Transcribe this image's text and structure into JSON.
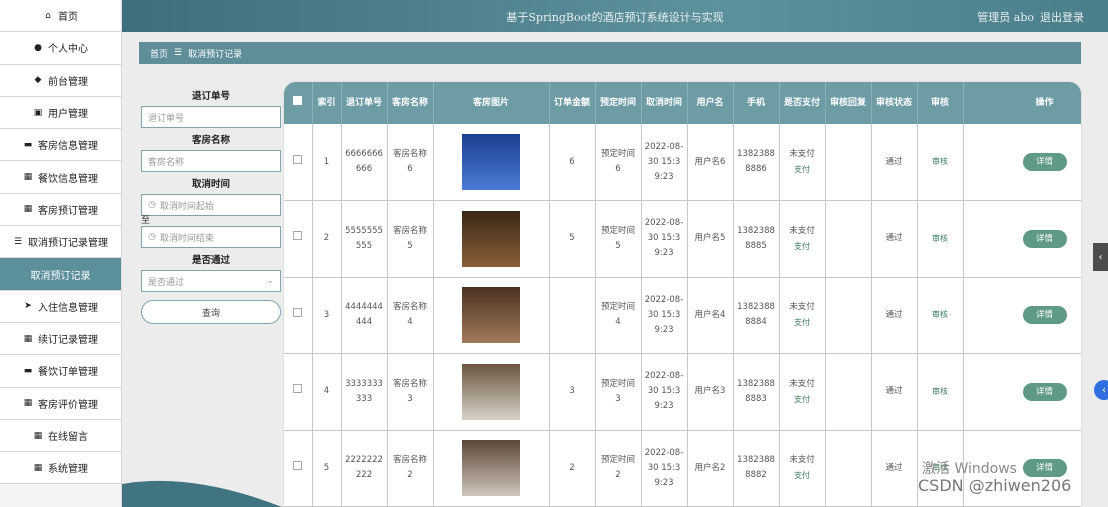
{
  "sidebar": {
    "items": [
      {
        "label": "首页",
        "icon": "home-icon",
        "glyph": "⌂"
      },
      {
        "label": "个人中心",
        "icon": "user-icon",
        "glyph": "●"
      },
      {
        "label": "前台管理",
        "icon": "pin-icon",
        "glyph": "◆"
      },
      {
        "label": "用户管理",
        "icon": "check-box-icon",
        "glyph": "▣"
      },
      {
        "label": "客房信息管理",
        "icon": "comment-icon",
        "glyph": "▬"
      },
      {
        "label": "餐饮信息管理",
        "icon": "grid-icon",
        "glyph": "▦"
      },
      {
        "label": "客房预订管理",
        "icon": "grid-icon",
        "glyph": "▦"
      },
      {
        "label": "取消预订记录管理",
        "icon": "sliders-icon",
        "glyph": "☰"
      },
      {
        "label": "取消预订记录",
        "icon": "",
        "glyph": ""
      },
      {
        "label": "入住信息管理",
        "icon": "send-icon",
        "glyph": "➤"
      },
      {
        "label": "续订记录管理",
        "icon": "grid-icon",
        "glyph": "▦"
      },
      {
        "label": "餐饮订单管理",
        "icon": "comment-icon",
        "glyph": "▬"
      },
      {
        "label": "客房评价管理",
        "icon": "grid-icon",
        "glyph": "▦"
      },
      {
        "label": "在线留言",
        "icon": "grid-icon",
        "glyph": "▦"
      },
      {
        "label": "系统管理",
        "icon": "grid-icon",
        "glyph": "▦"
      }
    ]
  },
  "header": {
    "title": "基于SpringBoot的酒店预订系统设计与实现",
    "user": "管理员 abo",
    "logout": "退出登录"
  },
  "breadcrumb": {
    "home": "首页",
    "separator": "☰",
    "current": "取消预订记录"
  },
  "search": {
    "order_label": "退订单号",
    "order_placeholder": "退订单号",
    "room_label": "客房名称",
    "room_placeholder": "客房名称",
    "cancel_time_label": "取消时间",
    "start_placeholder": "取消时间起始",
    "range_sep": "至",
    "end_placeholder": "取消时间结束",
    "passed_label": "是否通过",
    "passed_placeholder": "是否通过",
    "query_button": "查询"
  },
  "table": {
    "headers": [
      "",
      "索引",
      "退订单号",
      "客房名称",
      "客房图片",
      "订单金额",
      "预定时间",
      "取消时间",
      "用户名",
      "手机",
      "是否支付",
      "审核回复",
      "审核状态",
      "审核",
      "操作"
    ],
    "rows": [
      {
        "index": "1",
        "order_no": "6666666666",
        "room": "客房名称6",
        "amount": "6",
        "reserve": "预定时间6",
        "cancel": "2022-08-30 15:39:23",
        "user": "用户名6",
        "phone": "13823888886",
        "paid": "未支付",
        "pay_link": "支付",
        "reply": "",
        "status": "通过",
        "audit": "审核",
        "action": "详情",
        "img_top": "#1b3f8f",
        "img_bottom": "#4d7bd6"
      },
      {
        "index": "2",
        "order_no": "5555555555",
        "room": "客房名称5",
        "amount": "5",
        "reserve": "预定时间5",
        "cancel": "2022-08-30 15:39:23",
        "user": "用户名5",
        "phone": "13823888885",
        "paid": "未支付",
        "pay_link": "支付",
        "reply": "",
        "status": "通过",
        "audit": "审核",
        "action": "详情",
        "img_top": "#3a2716",
        "img_bottom": "#8a6038"
      },
      {
        "index": "3",
        "order_no": "4444444444",
        "room": "客房名称4",
        "amount": "",
        "reserve": "预定时间4",
        "cancel": "2022-08-30 15:39:23",
        "user": "用户名4",
        "phone": "13823888884",
        "paid": "未支付",
        "pay_link": "支付",
        "reply": "",
        "status": "通过",
        "audit": "审核",
        "action": "详情",
        "img_top": "#4a3122",
        "img_bottom": "#a27a58"
      },
      {
        "index": "4",
        "order_no": "3333333333",
        "room": "客房名称3",
        "amount": "3",
        "reserve": "预定时间3",
        "cancel": "2022-08-30 15:39:23",
        "user": "用户名3",
        "phone": "13823888883",
        "paid": "未支付",
        "pay_link": "支付",
        "reply": "",
        "status": "通过",
        "audit": "审核",
        "action": "详情",
        "img_top": "#6a5640",
        "img_bottom": "#d8d2c8"
      },
      {
        "index": "5",
        "order_no": "2222222222",
        "room": "客房名称2",
        "amount": "2",
        "reserve": "预定时间2",
        "cancel": "2022-08-30 15:39:23",
        "user": "用户名2",
        "phone": "13823888882",
        "paid": "未支付",
        "pay_link": "支付",
        "reply": "",
        "status": "通过",
        "audit": "审核",
        "action": "详情",
        "img_top": "#5c4838",
        "img_bottom": "#cfc6bb"
      }
    ]
  },
  "overlay": {
    "activate": "激活 Windows",
    "watermark": "CSDN @zhiwen206"
  },
  "colors": {
    "theme": "#5e8e98",
    "header": "#6d9ca5",
    "detail_button": "#5f9a86"
  }
}
